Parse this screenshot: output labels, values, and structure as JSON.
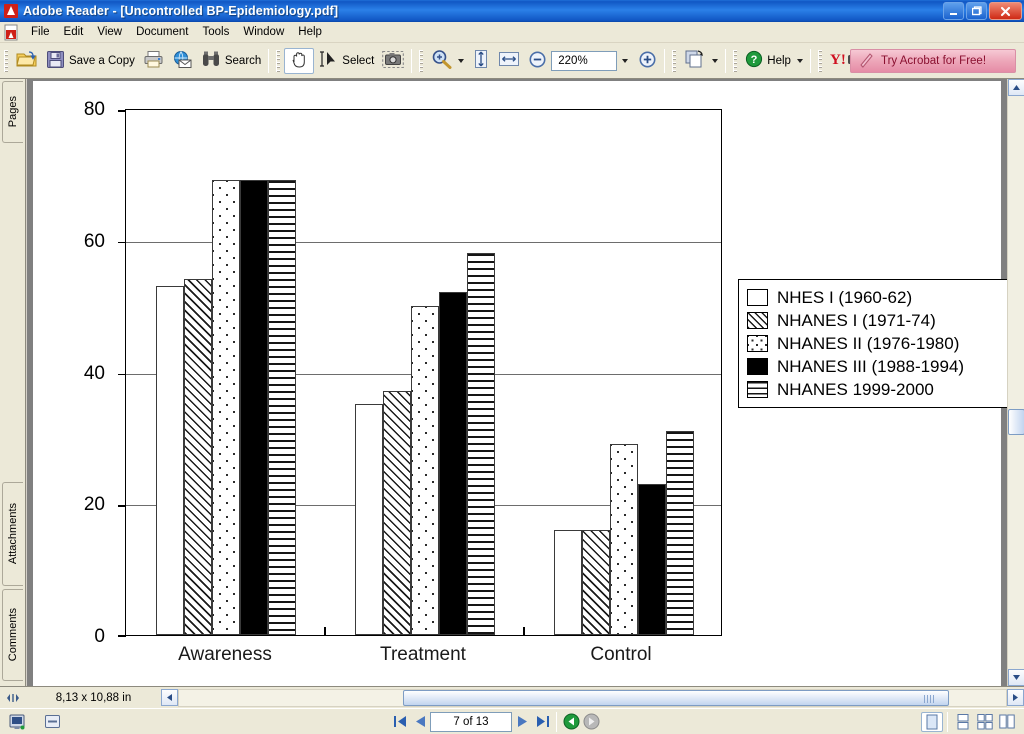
{
  "window": {
    "title": "Adobe Reader - [Uncontrolled BP-Epidemiology.pdf]",
    "app_icon": "adobe-reader-icon",
    "minimize_label": "_",
    "maximize_label": "❐",
    "close_label": "✕",
    "inner_minimize_label": "_",
    "inner_restore_label": "❐",
    "inner_close_label": "✕"
  },
  "menu": {
    "items": [
      {
        "label": "File"
      },
      {
        "label": "Edit"
      },
      {
        "label": "View"
      },
      {
        "label": "Document"
      },
      {
        "label": "Tools"
      },
      {
        "label": "Window"
      },
      {
        "label": "Help"
      }
    ]
  },
  "toolbar": {
    "open_icon": "open-folder-icon",
    "save_icon": "save-floppy-icon",
    "save_label": "Save a Copy",
    "print_icon": "printer-icon",
    "email_icon": "email-globe-icon",
    "search_icon": "binoculars-icon",
    "search_label": "Search",
    "hand_icon": "hand-tool-icon",
    "select_icon": "select-text-icon",
    "select_label": "Select",
    "snapshot_icon": "snapshot-camera-icon",
    "zoom_in_tool_icon": "magnifier-icon",
    "fit_height_icon": "fit-height-icon",
    "fit_width_icon": "fit-width-icon",
    "zoom_out_icon": "zoom-out-icon",
    "zoom_value": "220%",
    "zoom_in_icon": "zoom-in-icon",
    "rotate_icon": "rotate-page-icon",
    "help_icon": "help-question-icon",
    "help_label": "Help",
    "yahoo_icon": "yahoo-search-icon",
    "promo_icon": "acrobat-arrow-icon",
    "promo_label": "Try Acrobat for Free!"
  },
  "sidebar": {
    "tabs": [
      {
        "label": "Pages"
      },
      {
        "label": "Attachments"
      },
      {
        "label": "Comments"
      }
    ]
  },
  "statusbar": {
    "resize_icon": "resize-handle-icon",
    "page_size": "8,13 x 10,88 in",
    "scroll_left_icon": "scroll-left-icon",
    "first_page_icon": "first-page-icon",
    "prev_page_icon": "previous-page-icon",
    "page_value": "7 of 13",
    "next_page_icon": "next-page-icon",
    "last_page_icon": "last-page-icon",
    "prev_view_icon": "previous-view-icon",
    "next_view_icon": "next-view-icon",
    "single_page_icon": "single-page-view-icon",
    "continuous_icon": "continuous-view-icon",
    "facing_icon": "facing-pages-view-icon",
    "continuous_facing_icon": "continuous-facing-view-icon",
    "doc_status_icon": "document-status-icon",
    "signature_icon": "signature-panel-icon"
  },
  "chart_data": {
    "type": "bar",
    "title": "",
    "xlabel": "",
    "ylabel": "",
    "ylim": [
      0,
      80
    ],
    "yticks": [
      0,
      20,
      40,
      60,
      80
    ],
    "grid": true,
    "legend_position": "right",
    "categories": [
      "Awareness",
      "Treatment",
      "Control"
    ],
    "series": [
      {
        "name": "NHES I (1960-62)",
        "pattern": "solid-white",
        "values": [
          53,
          35,
          16
        ]
      },
      {
        "name": "NHANES I (1971-74)",
        "pattern": "diagonal",
        "values": [
          54,
          37,
          16
        ]
      },
      {
        "name": "NHANES II (1976-1980)",
        "pattern": "dotted",
        "values": [
          69,
          50,
          29
        ]
      },
      {
        "name": "NHANES III (1988-1994)",
        "pattern": "solid-black",
        "values": [
          69,
          52,
          23
        ]
      },
      {
        "name": "NHANES 1999-2000",
        "pattern": "horizontal",
        "values": [
          69,
          58,
          31
        ]
      }
    ]
  }
}
